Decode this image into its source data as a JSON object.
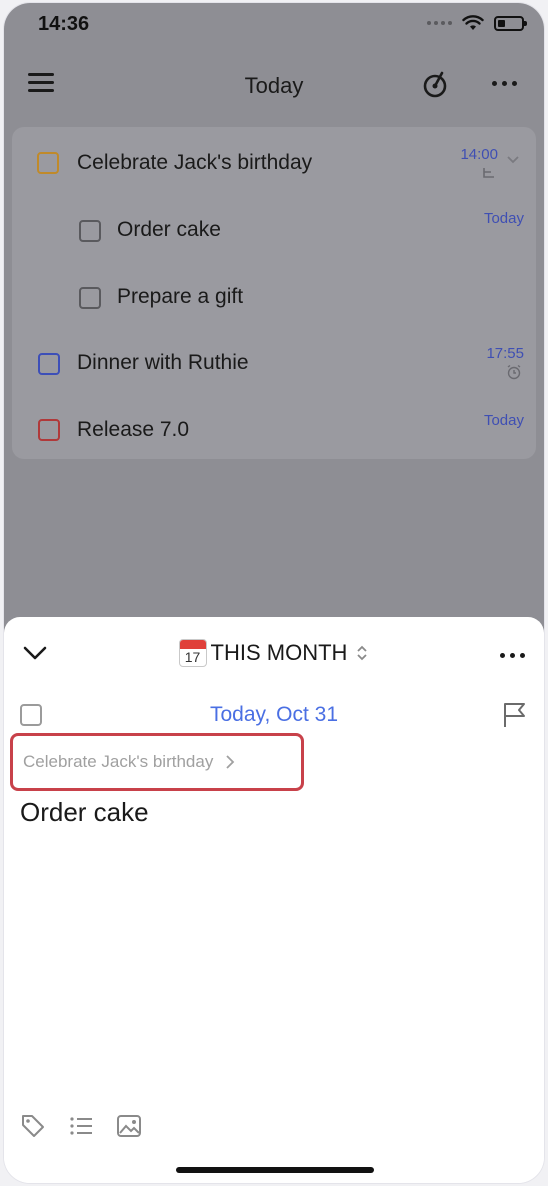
{
  "status_bar": {
    "time": "14:36",
    "battery_level": 0.3
  },
  "header": {
    "title": "Today"
  },
  "tasks": [
    {
      "title": "Celebrate Jack's birthday",
      "meta": "14:00",
      "meta_icon": "subtask-icon",
      "check_color": "#c08a2a",
      "expanded": true
    },
    {
      "title": "Order cake",
      "meta": "Today",
      "check_color": "#5a5a5e",
      "subtask": true
    },
    {
      "title": "Prepare a gift",
      "meta": "",
      "check_color": "#5a5a5e",
      "subtask": true
    },
    {
      "title": "Dinner with Ruthie",
      "meta": "17:55",
      "meta_icon": "alarm-icon",
      "check_color": "#3d4fb8"
    },
    {
      "title": "Release 7.0",
      "meta": "Today",
      "check_color": "#b0393a"
    }
  ],
  "sheet": {
    "calendar_icon_day": "17",
    "list_name": "THIS MONTH",
    "due_date": "Today, Oct 31",
    "parent_task": "Celebrate Jack's birthday",
    "task_title": "Order cake",
    "accent_color": "#4a6fe3",
    "highlight_color": "#c8414a"
  }
}
